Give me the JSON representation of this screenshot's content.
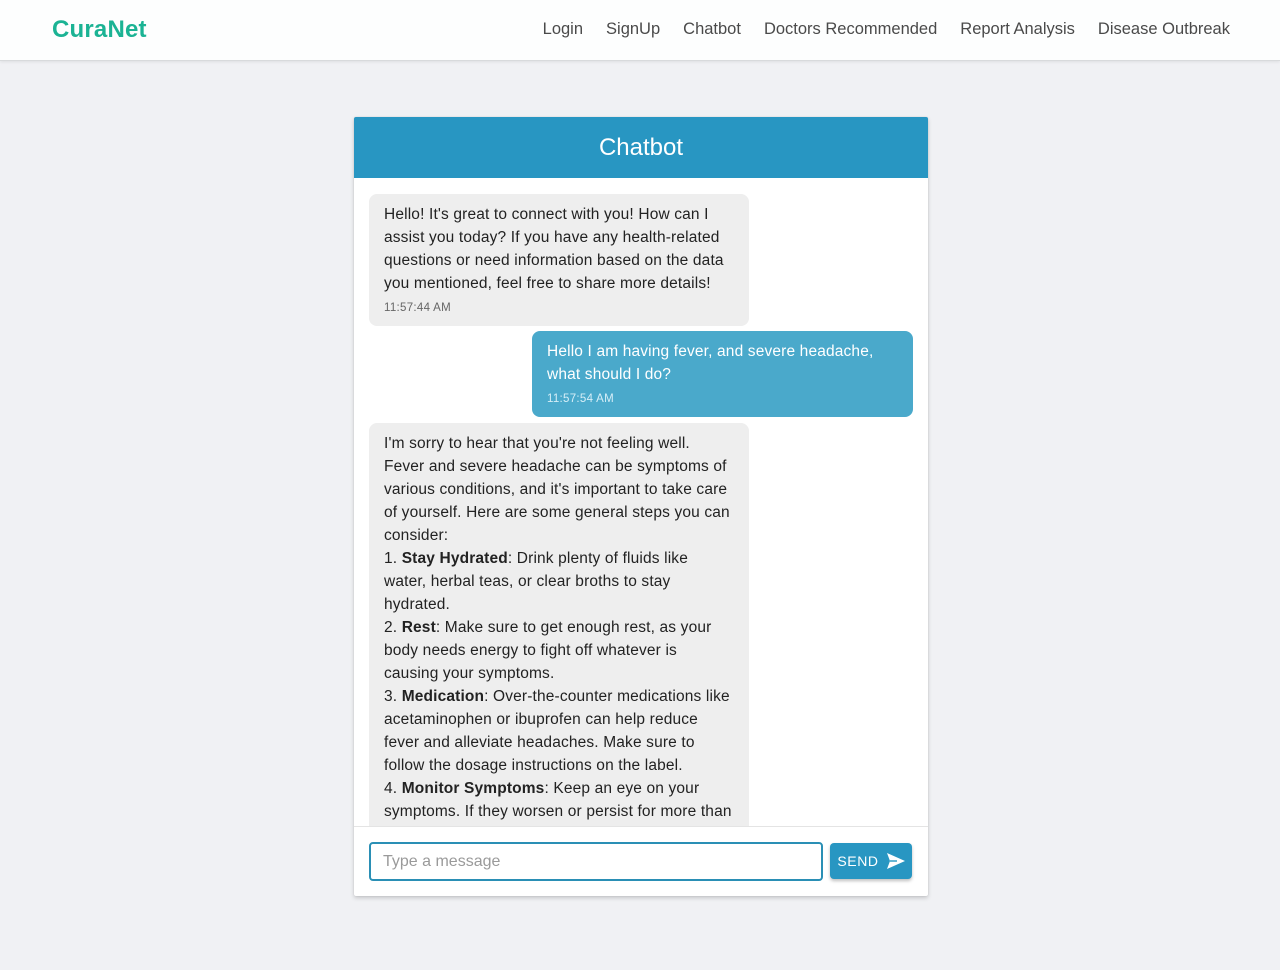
{
  "navbar": {
    "brand": "CuraNet",
    "links": [
      "Login",
      "SignUp",
      "Chatbot",
      "Doctors Recommended",
      "Report Analysis",
      "Disease Outbreak"
    ]
  },
  "chat": {
    "title": "Chatbot",
    "messages": [
      {
        "sender": "bot",
        "text": "Hello! It's great to connect with you! How can I assist you today? If you have any health-related questions or need information based on the data you mentioned, feel free to share more details!",
        "time": "11:57:44 AM"
      },
      {
        "sender": "user",
        "text": "Hello I am having fever, and severe headache, what should I do?",
        "time": "11:57:54 AM"
      },
      {
        "sender": "bot",
        "intro": "I'm sorry to hear that you're not feeling well. Fever and severe headache can be symptoms of various conditions, and it's important to take care of yourself. Here are some general steps you can consider:",
        "steps": [
          {
            "num": "1. ",
            "title": "Stay Hydrated",
            "text": ": Drink plenty of fluids like water, herbal teas, or clear broths to stay hydrated."
          },
          {
            "num": "2. ",
            "title": "Rest",
            "text": ": Make sure to get enough rest, as your body needs energy to fight off whatever is causing your symptoms."
          },
          {
            "num": "3. ",
            "title": "Medication",
            "text": ": Over-the-counter medications like acetaminophen or ibuprofen can help reduce fever and alleviate headaches. Make sure to follow the dosage instructions on the label."
          },
          {
            "num": "4. ",
            "title": "Monitor Symptoms",
            "text": ": Keep an eye on your symptoms. If they worsen or persist for more than a couple of days, it's important to seek medical"
          }
        ]
      }
    ],
    "input": {
      "placeholder": "Type a message",
      "value": ""
    },
    "send_label": "SEND",
    "send_icon": "send-icon"
  },
  "colors": {
    "brand": "#1bb394",
    "header": "#2896c2",
    "user_bubble": "#4aa9cb",
    "bot_bubble": "#eeeeee"
  }
}
